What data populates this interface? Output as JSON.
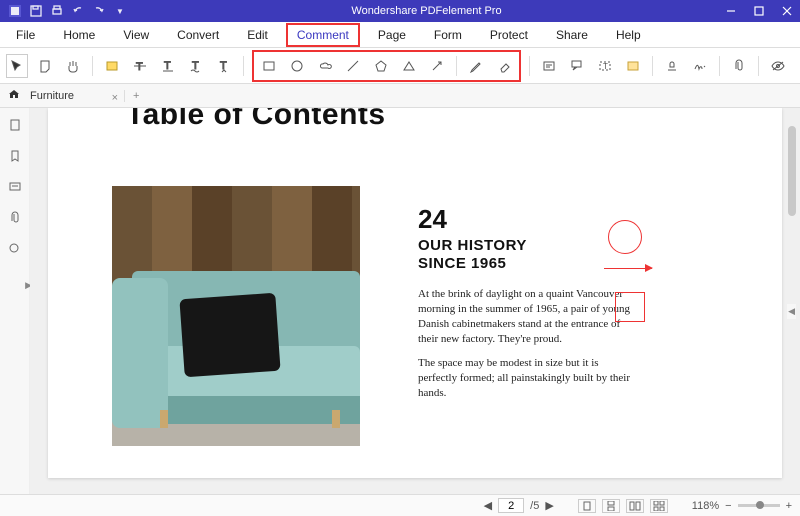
{
  "app": {
    "title": "Wondershare PDFelement Pro"
  },
  "menu": {
    "items": [
      "File",
      "Home",
      "View",
      "Convert",
      "Edit",
      "Comment",
      "Page",
      "Form",
      "Protect",
      "Share",
      "Help"
    ],
    "active": "Comment"
  },
  "tab": {
    "name": "Furniture",
    "new_label": "+"
  },
  "document": {
    "toc_title": "Table of Contents",
    "article": {
      "number": "24",
      "heading_line1": "OUR HISTORY",
      "heading_line2": "SINCE 1965",
      "para1": "At the brink of daylight on a quaint Vancouver morning in the summer of 1965, a pair of young Danish cabinetmakers stand at the entrance of their new factory. They're proud.",
      "para2": "The space may be modest in size but it is perfectly formed; all painstakingly built by their hands."
    }
  },
  "status": {
    "page_current": "2",
    "page_total": "/5",
    "zoom": "118%",
    "minus": "−",
    "plus": "+"
  },
  "icons": {
    "close_tab": "×"
  }
}
